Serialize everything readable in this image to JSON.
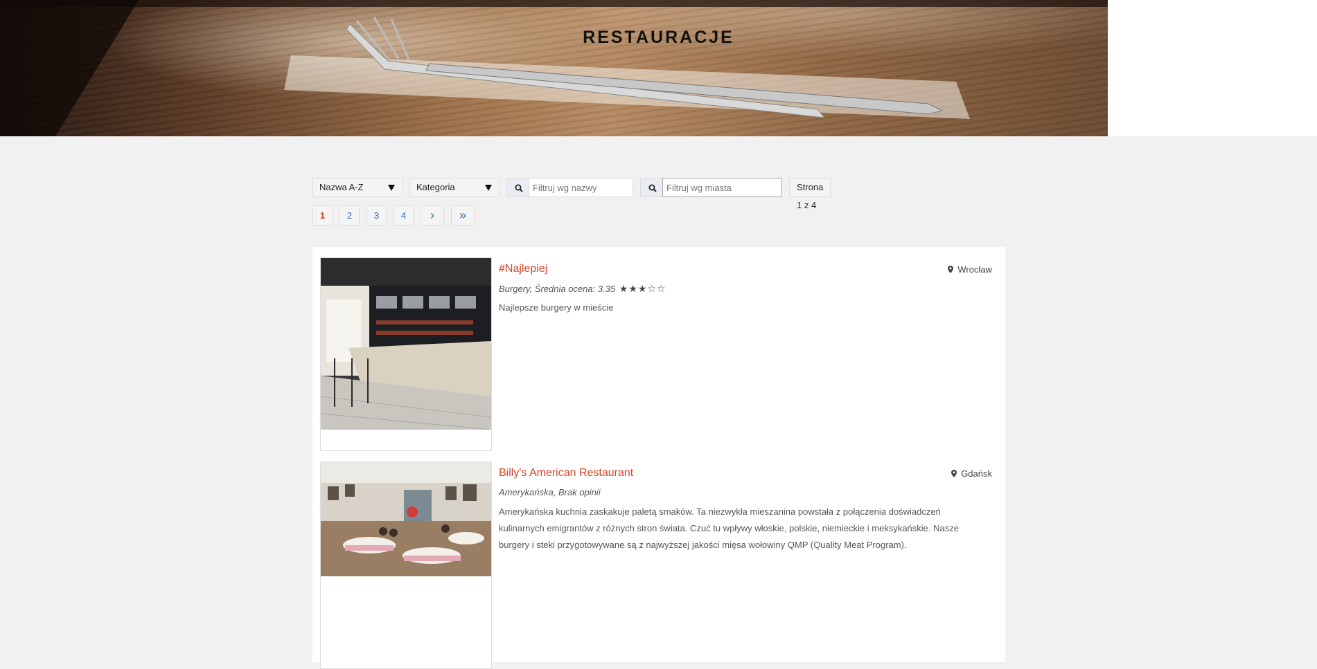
{
  "hero": {
    "title": "RESTAURACJE"
  },
  "toolbar": {
    "sort_select": "Nazwa A-Z",
    "category_select": "Kategoria",
    "name_filter_placeholder": "Filtruj wg nazwy",
    "city_filter_placeholder": "Filtruj wg miasta",
    "page_info": "Strona 1 z 4"
  },
  "pagination": {
    "pages": [
      "1",
      "2",
      "3",
      "4"
    ],
    "current": "1",
    "next": "›",
    "last": "»"
  },
  "restaurants": [
    {
      "name": "#Najlepiej",
      "city": "Wrocław",
      "meta": "Burgery, Średnia ocena: 3.35",
      "rating_stars": 3,
      "max_stars": 5,
      "stars_display": "★★★☆☆",
      "description": "Najlepsze burgery w mieście"
    },
    {
      "name": "Billy's American Restaurant",
      "city": "Gdańsk",
      "meta": "Amerykańska, Brak opinii",
      "description": "Amerykańska kuchnia zaskakuje paletą smaków. Ta niezwykła mieszanina powstała z połączenia doświadczeń kulinarnych emigrantów z różnych stron świata. Czuć tu wpływy włoskie, polskie, niemieckie i meksykańskie. Nasze burgery i steki przygotowywane są z najwyższej jakości mięsa wołowiny QMP (Quality Meat Program)."
    }
  ],
  "icons": {
    "search": "search-icon",
    "location": "map-marker-icon",
    "dropdown": "caret-down-icon"
  },
  "colors": {
    "accent": "#d64526",
    "link": "#2a6ebb",
    "background": "#f1f1f1"
  }
}
